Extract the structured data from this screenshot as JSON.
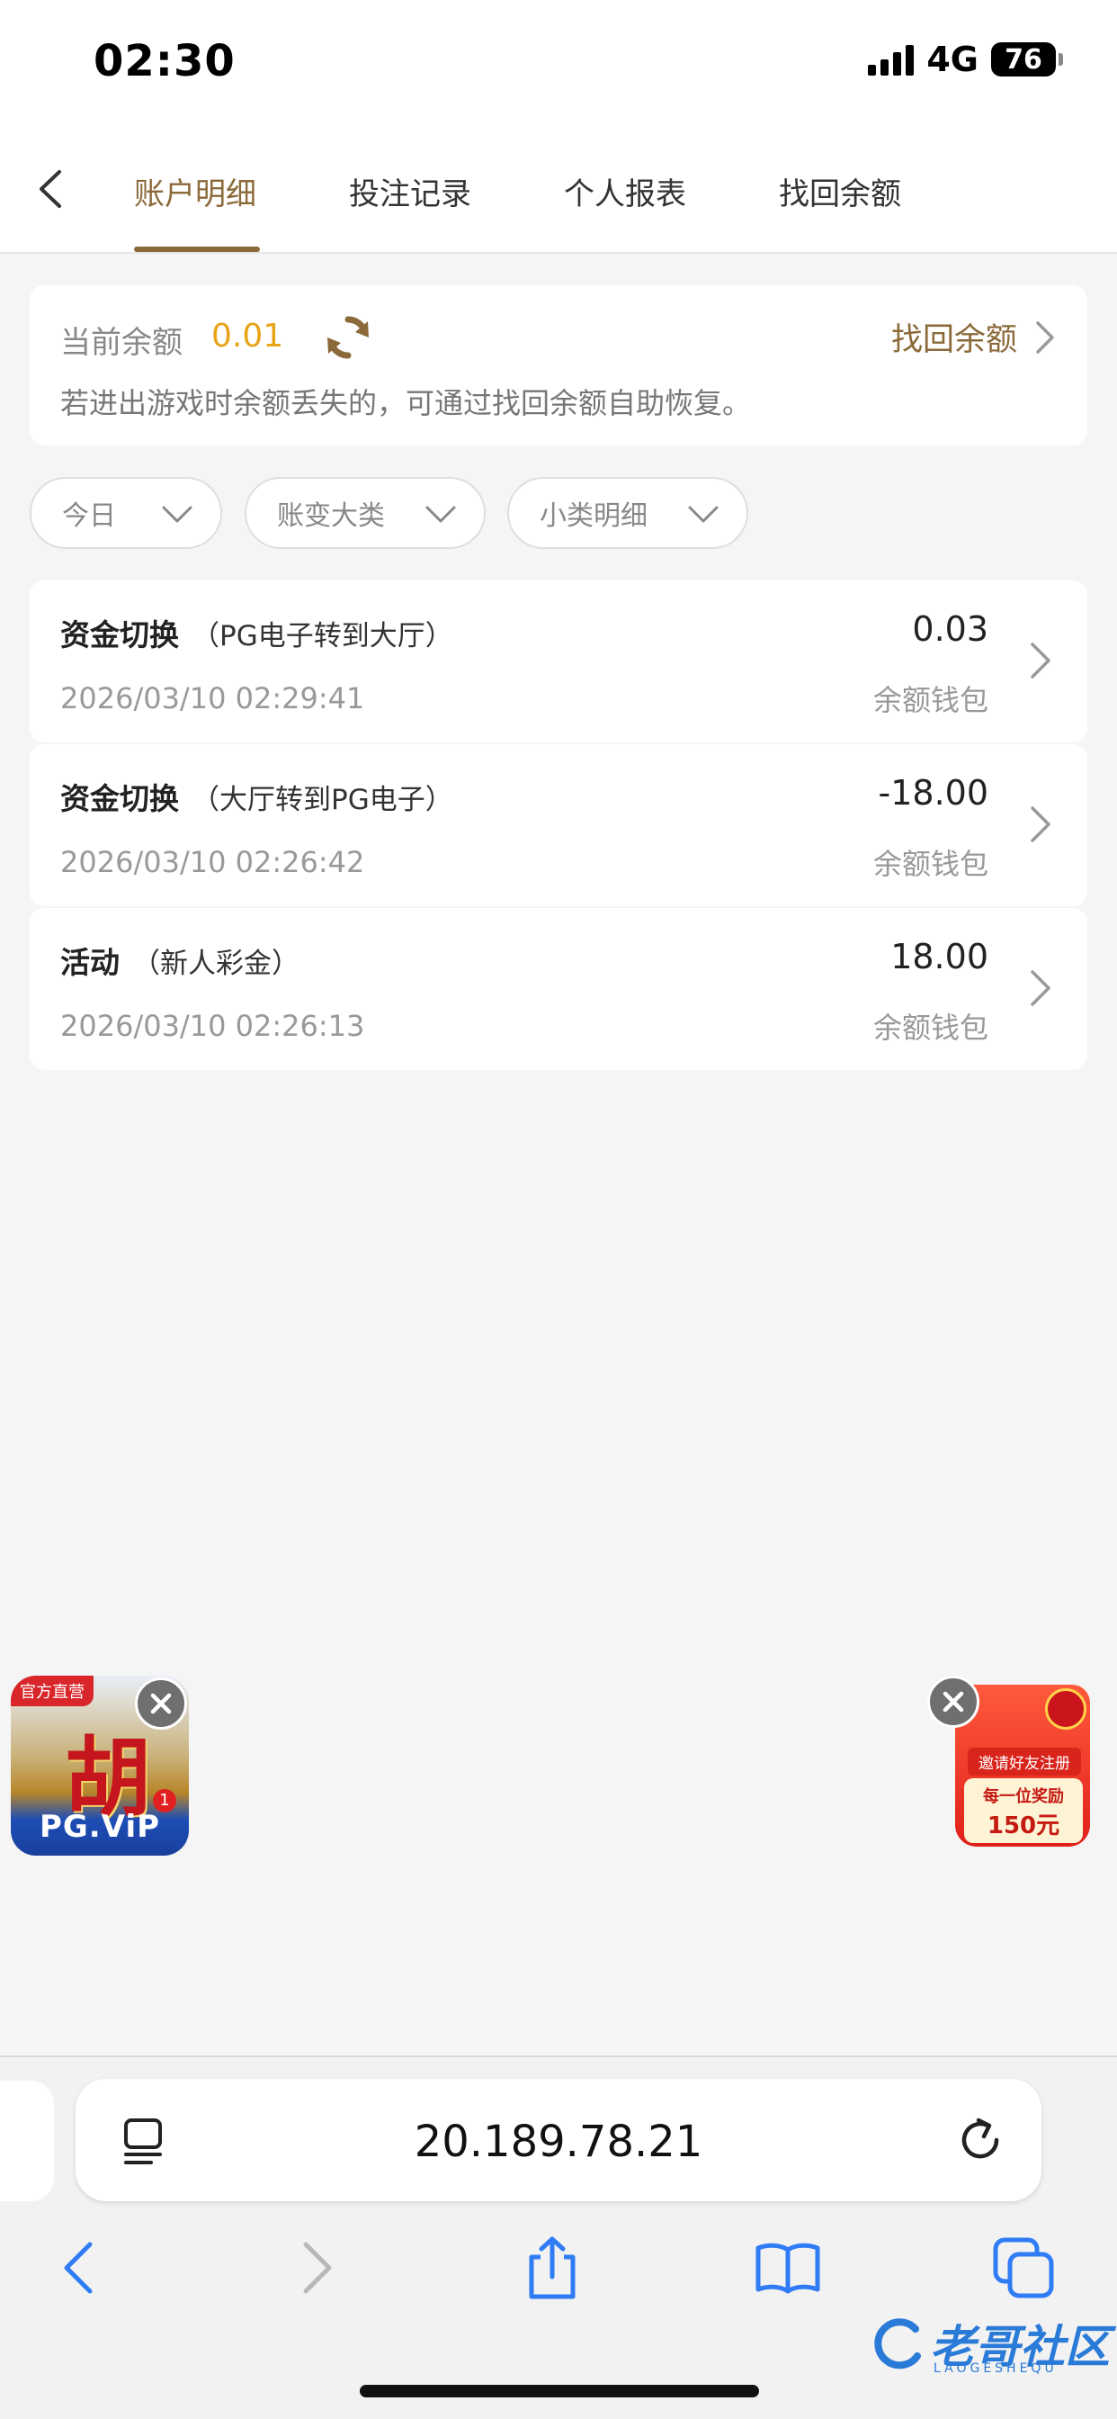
{
  "status_bar": {
    "time": "02:30",
    "network": "4G",
    "battery": "76"
  },
  "tabs": [
    {
      "label": "账户明细",
      "active": true
    },
    {
      "label": "投注记录",
      "active": false
    },
    {
      "label": "个人报表",
      "active": false
    },
    {
      "label": "找回余额",
      "active": false
    }
  ],
  "balance": {
    "label": "当前余额",
    "value": "0.01",
    "recover_label": "找回余额",
    "note": "若进出游戏时余额丢失的，可通过找回余额自助恢复。"
  },
  "filters": [
    {
      "label": "今日"
    },
    {
      "label": "账变大类"
    },
    {
      "label": "小类明细"
    }
  ],
  "records": [
    {
      "type": "资金切换",
      "detail": "（PG电子转到大厅）",
      "time": "2026/03/10 02:29:41",
      "amount": "0.03",
      "wallet": "余额钱包"
    },
    {
      "type": "资金切换",
      "detail": "（大厅转到PG电子）",
      "time": "2026/03/10 02:26:42",
      "amount": "-18.00",
      "wallet": "余额钱包"
    },
    {
      "type": "活动",
      "detail": "（新人彩金）",
      "time": "2026/03/10 02:26:13",
      "amount": "18.00",
      "wallet": "余额钱包"
    }
  ],
  "ads": {
    "left": {
      "tag": "官方直营",
      "char": "胡",
      "brand": "PG.ViP",
      "badge": "1"
    },
    "right": {
      "invite": "邀请好友注册",
      "reward_line": "每一位奖励",
      "reward_amount": "150元"
    }
  },
  "browser": {
    "url": "20.189.78.21"
  },
  "watermark": {
    "text": "老哥社区",
    "sub": "LAOGESHEQU"
  },
  "colors": {
    "accent": "#8b6a3a",
    "balance": "#e8a317",
    "link_blue": "#2a7ad8"
  }
}
